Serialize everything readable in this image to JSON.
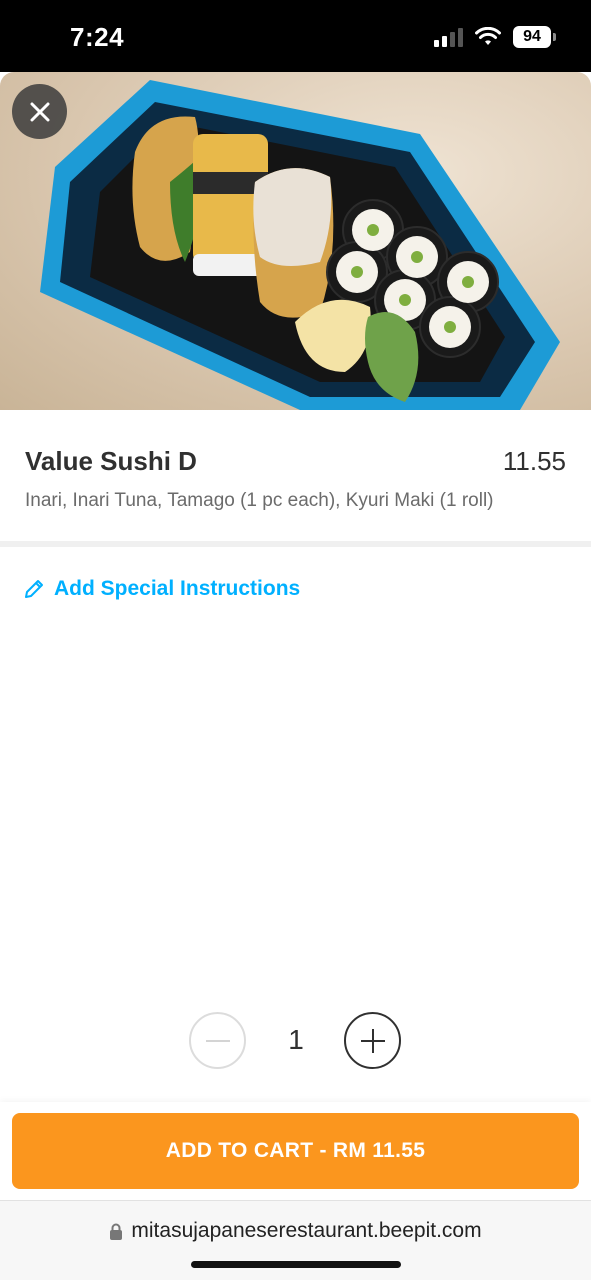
{
  "status_bar": {
    "time": "7:24",
    "battery": "94"
  },
  "product": {
    "name": "Value Sushi D",
    "price": "11.55",
    "description": "Inari, Inari Tuna, Tamago (1 pc each), Kyuri Maki (1 roll)",
    "image_alt": "sushi-set-photo"
  },
  "instructions": {
    "label": "Add Special Instructions"
  },
  "quantity": {
    "value": "1"
  },
  "cart": {
    "button_label": "ADD TO CART - RM 11.55"
  },
  "browser": {
    "url": "mitasujapaneserestaurant.beepit.com"
  },
  "colors": {
    "accent": "#00b0ff",
    "cart": "#fb961e",
    "text": "#303030",
    "muted": "#6b6b6b"
  }
}
